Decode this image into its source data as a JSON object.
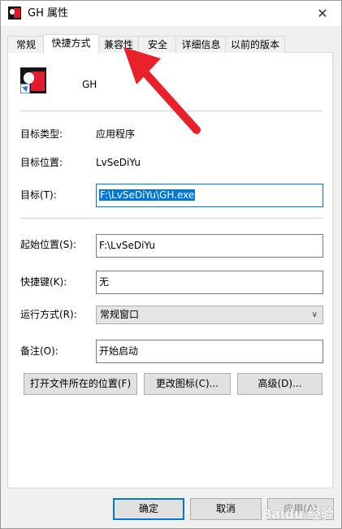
{
  "window": {
    "title": "GH 属性",
    "close_glyph": "✕"
  },
  "tabs": [
    {
      "label": "常规"
    },
    {
      "label": "快捷方式"
    },
    {
      "label": "兼容性"
    },
    {
      "label": "安全"
    },
    {
      "label": "详细信息"
    },
    {
      "label": "以前的版本"
    }
  ],
  "active_tab": "快捷方式",
  "shortcut": {
    "name": "GH",
    "target_type_label": "目标类型:",
    "target_type_value": "应用程序",
    "target_location_label": "目标位置:",
    "target_location_value": "LvSeDiYu",
    "target_label": "目标(T):",
    "target_value": "F:\\LvSeDiYu\\GH.exe",
    "start_in_label": "起始位置(S):",
    "start_in_value": "F:\\LvSeDiYu",
    "hotkey_label": "快捷键(K):",
    "hotkey_value": "无",
    "run_label": "运行方式(R):",
    "run_value": "常规窗口",
    "comment_label": "备注(O):",
    "comment_value": "开始启动"
  },
  "buttons": {
    "open_location": "打开文件所在的位置(F)",
    "change_icon": "更改图标(C)...",
    "advanced": "高级(D)...",
    "ok": "确定",
    "cancel": "取消",
    "apply": "应用(A)"
  },
  "icons": {
    "app_icon": "gh-app-icon",
    "close": "close-icon",
    "dropdown": "chevron-down-icon"
  },
  "colors": {
    "accent": "#0078d7",
    "annotation_arrow": "#e8212b"
  },
  "watermark": "Baidu 经验"
}
